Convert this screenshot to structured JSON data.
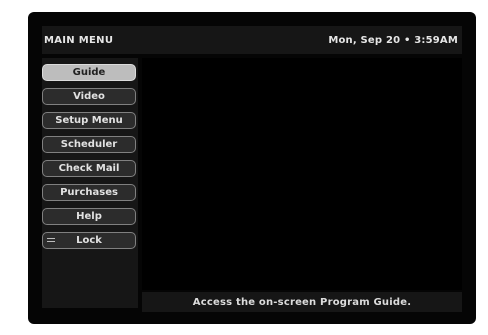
{
  "header": {
    "title": "MAIN MENU",
    "datetime": "Mon, Sep 20 • 3:59AM"
  },
  "menu": {
    "selected_index": 0,
    "items": [
      {
        "label": "Guide"
      },
      {
        "label": "Video"
      },
      {
        "label": "Setup Menu"
      },
      {
        "label": "Scheduler"
      },
      {
        "label": "Check Mail"
      },
      {
        "label": "Purchases"
      },
      {
        "label": "Help"
      },
      {
        "label": "Lock",
        "icon": "lock-icon"
      }
    ]
  },
  "status": {
    "help_text": "Access the on-screen Program Guide."
  },
  "colors": {
    "background": "#050505",
    "panel": "#161616",
    "button": "#2c2c2c",
    "button_selected": "#bdbdbd",
    "text": "#e6e6e6"
  }
}
